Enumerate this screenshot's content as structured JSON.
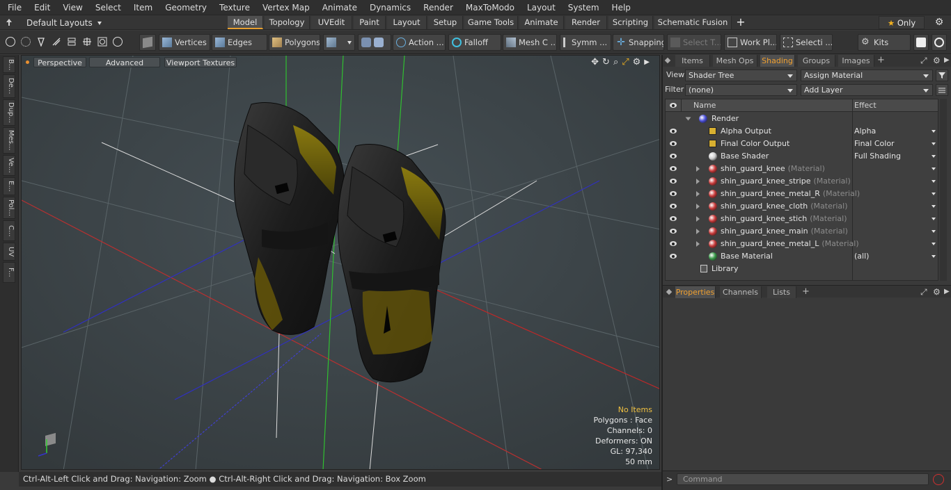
{
  "menu": [
    "File",
    "Edit",
    "View",
    "Select",
    "Item",
    "Geometry",
    "Texture",
    "Vertex Map",
    "Animate",
    "Dynamics",
    "Render",
    "MaxToModo",
    "Layout",
    "System",
    "Help"
  ],
  "layout_selector": "Default Layouts",
  "mode_tabs": [
    "Model",
    "Topology",
    "UVEdit",
    "Paint",
    "Layout",
    "Setup",
    "Game Tools",
    "Animate",
    "Render",
    "Scripting",
    "Schematic Fusion"
  ],
  "active_mode_tab": "Model",
  "only_button": "Only",
  "toolbar": {
    "vertices": "Vertices",
    "edges": "Edges",
    "polygons": "Polygons",
    "action": "Action ...",
    "falloff": "Falloff",
    "mesh": "Mesh C ...",
    "symmetry": "Symm ...",
    "snapping": "Snapping",
    "select_tool": "Select T...",
    "work_plane": "Work Pl...",
    "selection": "Selecti ...",
    "kits": "Kits"
  },
  "left_tabs": [
    "B...",
    "De...",
    "Dup...",
    "Mes...",
    "Ve...",
    "E...",
    "Pol...",
    "C...",
    "UV",
    "F..."
  ],
  "viewport": {
    "perspective": "Perspective",
    "advanced": "Advanced",
    "textures": "Viewport Textures",
    "info": {
      "no_items": "No Items",
      "polygons": "Polygons : Face",
      "channels": "Channels: 0",
      "deformers": "Deformers: ON",
      "gl": "GL: 97,340",
      "scale": "50 mm"
    }
  },
  "status": "Ctrl-Alt-Left Click and Drag: Navigation: Zoom ● Ctrl-Alt-Right Click and Drag: Navigation: Box Zoom",
  "panel_tabs": [
    "Items",
    "Mesh Ops",
    "Shading",
    "Groups",
    "Images"
  ],
  "active_panel_tab": "Shading",
  "shading": {
    "view_label": "View",
    "view_value": "Shader Tree",
    "assign_material": "Assign Material",
    "filter_label": "Filter",
    "filter_value": "(none)",
    "add_layer": "Add Layer",
    "col_name": "Name",
    "col_effect": "Effect",
    "rows": [
      {
        "name": "Render",
        "suffix": "",
        "effect": "",
        "kind": "render",
        "color": "#4a4fd8"
      },
      {
        "name": "Alpha Output",
        "suffix": "",
        "effect": "Alpha",
        "kind": "output",
        "color": "#d8b030"
      },
      {
        "name": "Final Color Output",
        "suffix": "",
        "effect": "Final Color",
        "kind": "output",
        "color": "#d8b030"
      },
      {
        "name": "Base Shader",
        "suffix": "",
        "effect": "Full Shading",
        "kind": "shader",
        "color": "#cfcfcf"
      },
      {
        "name": "shin_guard_knee",
        "suffix": "(Material)",
        "effect": "",
        "kind": "material",
        "color": "#c83a3a"
      },
      {
        "name": "shin_guard_knee_stripe",
        "suffix": "(Material)",
        "effect": "",
        "kind": "material",
        "color": "#c83a3a"
      },
      {
        "name": "shin_guard_knee_metal_R",
        "suffix": "(Material)",
        "effect": "",
        "kind": "material",
        "color": "#c83a3a"
      },
      {
        "name": "shin_guard_knee_cloth",
        "suffix": "(Material)",
        "effect": "",
        "kind": "material",
        "color": "#c83a3a"
      },
      {
        "name": "shin_guard_knee_stich",
        "suffix": "(Material)",
        "effect": "",
        "kind": "material",
        "color": "#c83a3a"
      },
      {
        "name": "shin_guard_knee_main",
        "suffix": "(Material)",
        "effect": "",
        "kind": "material",
        "color": "#c83a3a"
      },
      {
        "name": "shin_guard_knee_metal_L",
        "suffix": "(Material)",
        "effect": "",
        "kind": "material",
        "color": "#c83a3a"
      },
      {
        "name": "Base Material",
        "suffix": "",
        "effect": "(all)",
        "kind": "basemat",
        "color": "#3a9a4a"
      },
      {
        "name": "Library",
        "suffix": "",
        "effect": "",
        "kind": "library",
        "color": ""
      }
    ]
  },
  "props_tabs": [
    "Properties",
    "Channels",
    "Lists"
  ],
  "active_props_tab": "Properties",
  "command_placeholder": "Command"
}
